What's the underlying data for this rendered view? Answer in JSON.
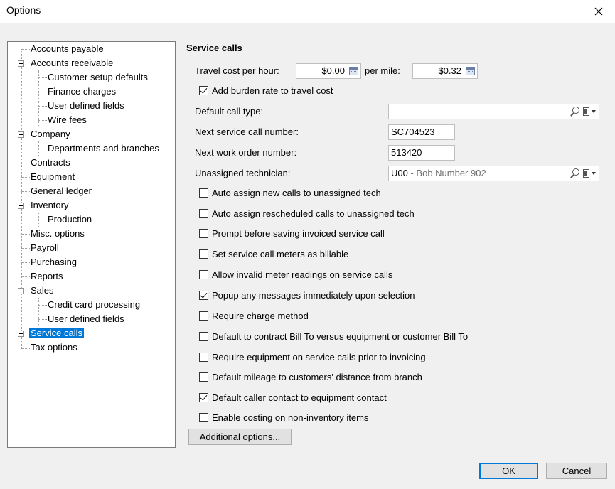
{
  "window": {
    "title": "Options"
  },
  "tree": {
    "items": [
      {
        "label": "Accounts payable"
      },
      {
        "label": "Accounts receivable"
      },
      {
        "label": "Customer setup defaults"
      },
      {
        "label": "Finance charges"
      },
      {
        "label": "User defined fields"
      },
      {
        "label": "Wire fees"
      },
      {
        "label": "Company"
      },
      {
        "label": "Departments and branches"
      },
      {
        "label": "Contracts"
      },
      {
        "label": "Equipment"
      },
      {
        "label": "General ledger"
      },
      {
        "label": "Inventory"
      },
      {
        "label": "Production"
      },
      {
        "label": "Misc. options"
      },
      {
        "label": "Payroll"
      },
      {
        "label": "Purchasing"
      },
      {
        "label": "Reports"
      },
      {
        "label": "Sales"
      },
      {
        "label": "Credit card processing"
      },
      {
        "label": "User defined fields"
      },
      {
        "label": "Service calls"
      },
      {
        "label": "Tax options"
      }
    ]
  },
  "panel": {
    "title": "Service calls",
    "travel_cost_label": "Travel cost per hour:",
    "travel_cost_value": "$0.00",
    "per_mile_label": "per mile:",
    "per_mile_value": "$0.32",
    "burden_label": "Add burden rate to travel cost",
    "default_call_type_label": "Default call type:",
    "default_call_type_value": "",
    "next_call_label": "Next service call number:",
    "next_call_value": "SC704523",
    "next_wo_label": "Next work order number:",
    "next_wo_value": "513420",
    "unassigned_label": "Unassigned technician:",
    "unassigned_code": "U00",
    "unassigned_name": " - Bob Number 902",
    "checkboxes": [
      {
        "label": "Auto assign new calls to unassigned tech",
        "checked": false
      },
      {
        "label": "Auto assign rescheduled calls to unassigned tech",
        "checked": false
      },
      {
        "label": "Prompt before saving invoiced service call",
        "checked": false
      },
      {
        "label": "Set service call meters as billable",
        "checked": false
      },
      {
        "label": "Allow invalid meter readings on service calls",
        "checked": false
      },
      {
        "label": "Popup any messages immediately upon selection",
        "checked": true
      },
      {
        "label": "Require charge method",
        "checked": false
      },
      {
        "label": "Default to contract Bill To versus equipment or customer Bill To",
        "checked": false
      },
      {
        "label": "Require equipment on service calls prior to invoicing",
        "checked": false
      },
      {
        "label": "Default mileage to customers' distance from branch",
        "checked": false
      },
      {
        "label": "Default caller contact to equipment contact",
        "checked": true
      },
      {
        "label": "Enable costing on non-inventory items",
        "checked": false
      }
    ],
    "additional_options_label": "Additional options..."
  },
  "footer": {
    "ok_label": "OK",
    "cancel_label": "Cancel"
  }
}
